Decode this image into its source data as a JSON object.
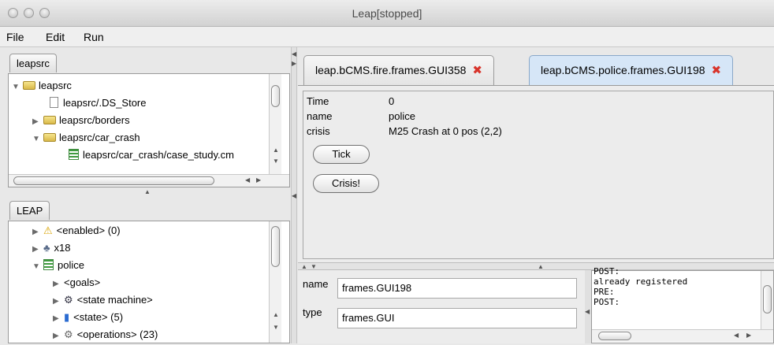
{
  "window": {
    "title": "Leap[stopped]"
  },
  "menu": {
    "file": "File",
    "edit": "Edit",
    "run": "Run"
  },
  "left_top": {
    "tab": "leapsrc",
    "tree": [
      {
        "label": "leapsrc"
      },
      {
        "label": "leapsrc/.DS_Store"
      },
      {
        "label": "leapsrc/borders"
      },
      {
        "label": "leapsrc/car_crash"
      },
      {
        "label": "leapsrc/car_crash/case_study.cm"
      }
    ]
  },
  "left_bottom": {
    "tab": "LEAP",
    "tree": [
      {
        "label": "<enabled> (0)"
      },
      {
        "label": "x18"
      },
      {
        "label": "police"
      },
      {
        "label": "<goals>"
      },
      {
        "label": "<state machine>"
      },
      {
        "label": "<state> (5)"
      },
      {
        "label": "<operations> (23)"
      }
    ]
  },
  "tabs": [
    {
      "label": "leap.bCMS.fire.frames.GUI358"
    },
    {
      "label": "leap.bCMS.police.frames.GUI198"
    }
  ],
  "gui": {
    "rows": [
      {
        "key": "Time",
        "value": "0"
      },
      {
        "key": "name",
        "value": "police"
      },
      {
        "key": "crisis",
        "value": "M25 Crash at 0 pos (2,2)"
      }
    ],
    "tick_button": "Tick",
    "crisis_button": "Crisis!"
  },
  "props": {
    "name_label": "name",
    "name_value": "frames.GUI198",
    "type_label": "type",
    "type_value": "frames.GUI"
  },
  "log": {
    "lines": [
      "POST:",
      "already registered",
      "PRE:",
      "POST:"
    ]
  },
  "colors": {
    "active_tab": "#d6e6f7",
    "close_icon": "#d8342b"
  }
}
